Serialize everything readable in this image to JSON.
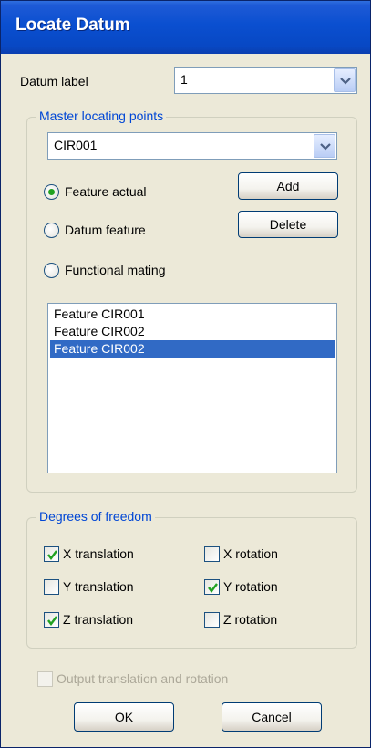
{
  "window": {
    "title": "Locate Datum"
  },
  "datum_label": {
    "label": "Datum label",
    "value": "1"
  },
  "master": {
    "group_title": "Master locating points",
    "combo_value": "CIR001",
    "radios": [
      {
        "label": "Feature actual",
        "selected": true
      },
      {
        "label": "Datum feature",
        "selected": false
      },
      {
        "label": "Functional mating",
        "selected": false
      }
    ],
    "add_label": "Add",
    "delete_label": "Delete",
    "list_items": [
      {
        "text": "Feature CIR001",
        "selected": false
      },
      {
        "text": "Feature CIR002",
        "selected": false
      },
      {
        "text": "Feature CIR002",
        "selected": true
      }
    ]
  },
  "dof": {
    "group_title": "Degrees of freedom",
    "x_translation": {
      "label": "X translation",
      "checked": true
    },
    "y_translation": {
      "label": "Y translation",
      "checked": false
    },
    "z_translation": {
      "label": "Z translation",
      "checked": true
    },
    "x_rotation": {
      "label": "X rotation",
      "checked": false
    },
    "y_rotation": {
      "label": "Y rotation",
      "checked": true
    },
    "z_rotation": {
      "label": "Z rotation",
      "checked": false
    }
  },
  "output": {
    "label": "Output translation and rotation",
    "checked": false,
    "enabled": false
  },
  "buttons": {
    "ok": "OK",
    "cancel": "Cancel"
  },
  "colors": {
    "title_bar": "#0a4fd0",
    "group_title": "#0046d5",
    "selection": "#316ac5",
    "check_mark": "#21a121"
  }
}
